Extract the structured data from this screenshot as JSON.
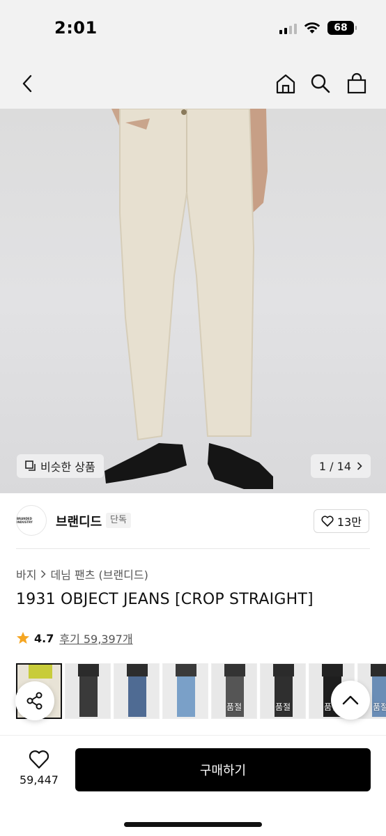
{
  "status_bar": {
    "time": "2:01",
    "battery": "68"
  },
  "nav": {
    "back_icon": "chevron-left-icon",
    "home_icon": "home-icon",
    "search_icon": "search-icon",
    "bag_icon": "shopping-bag-icon"
  },
  "gallery": {
    "similar_label": "비슷한 상품",
    "counter": "1 / 14"
  },
  "brand": {
    "logo_text": "BRANDED INDUSTRY",
    "name": "브랜디드",
    "badge": "단독",
    "likes": "13만"
  },
  "breadcrumb": {
    "category": "바지",
    "subcategory": "데님 팬츠 (브랜디드)"
  },
  "product": {
    "title": "1931 OBJECT JEANS [CROP STRAIGHT]",
    "rating": "4.7",
    "reviews": "후기 59,397개"
  },
  "thumbnails": [
    {
      "soldout": "",
      "color": "#e8e3d6",
      "top": "#c8cc3a",
      "pants": "#ebe6d8"
    },
    {
      "soldout": "",
      "color": "#e9e9e9",
      "top": "#2b2b2b",
      "pants": "#3a3a3a"
    },
    {
      "soldout": "",
      "color": "#eaeaea",
      "top": "#2d2d2d",
      "pants": "#4f6b93"
    },
    {
      "soldout": "",
      "color": "#ebebeb",
      "top": "#3a3a3a",
      "pants": "#7aa0c8"
    },
    {
      "soldout": "품절",
      "color": "#e8e8e8",
      "top": "#333333",
      "pants": "#555555"
    },
    {
      "soldout": "품절",
      "color": "#e8e8e8",
      "top": "#2b2b2b",
      "pants": "#2f2f2f"
    },
    {
      "soldout": "품절",
      "color": "#e8e8e8",
      "top": "#222222",
      "pants": "#1e1e1e"
    },
    {
      "soldout": "품절",
      "color": "#e8e8e8",
      "top": "#2b2b2b",
      "pants": "#6a8db6"
    }
  ],
  "bottom": {
    "wish_count": "59,447",
    "buy_label": "구매하기"
  },
  "colors": {
    "accent": "#000000",
    "star": "#f5a623"
  }
}
